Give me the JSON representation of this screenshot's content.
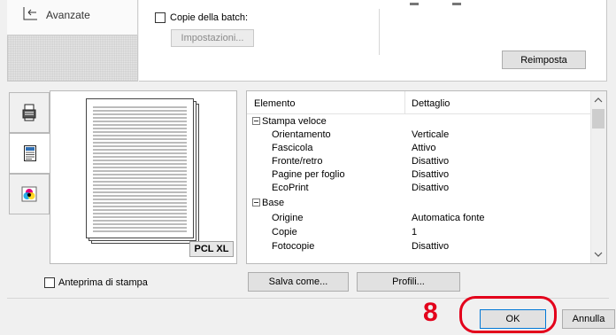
{
  "nav": {
    "back_label": "Avanzate"
  },
  "batch": {
    "label": "Copie della batch:",
    "settings_button": "Impostazioni..."
  },
  "reset_button": "Reimposta",
  "tabs": [
    {
      "name": "printer-tab",
      "icon": "printer-icon"
    },
    {
      "name": "document-tab",
      "icon": "document-icon"
    },
    {
      "name": "color-tab",
      "icon": "color-icon"
    }
  ],
  "preview": {
    "badge": "PCL XL",
    "checkbox_label": "Anteprima di stampa"
  },
  "list": {
    "headers": {
      "item": "Elemento",
      "detail": "Dettaglio"
    },
    "rows": [
      {
        "type": "group",
        "label": "Stampa veloce"
      },
      {
        "type": "item",
        "label": "Orientamento",
        "value": "Verticale"
      },
      {
        "type": "item",
        "label": "Fascicola",
        "value": "Attivo"
      },
      {
        "type": "item",
        "label": "Fronte/retro",
        "value": "Disattivo"
      },
      {
        "type": "item",
        "label": "Pagine per foglio",
        "value": "Disattivo"
      },
      {
        "type": "item",
        "label": "EcoPrint",
        "value": "Disattivo"
      },
      {
        "type": "group",
        "label": "Base"
      },
      {
        "type": "item",
        "label": "Origine",
        "value": "Automatica fonte"
      },
      {
        "type": "item",
        "label": "Copie",
        "value": "1"
      },
      {
        "type": "item",
        "label": "Fotocopie",
        "value": "Disattivo"
      }
    ]
  },
  "buttons": {
    "save_as": "Salva come...",
    "profiles": "Profili...",
    "ok": "OK",
    "cancel": "Annulla"
  },
  "annotation": {
    "step_number": "8",
    "color": "#e3001b"
  }
}
